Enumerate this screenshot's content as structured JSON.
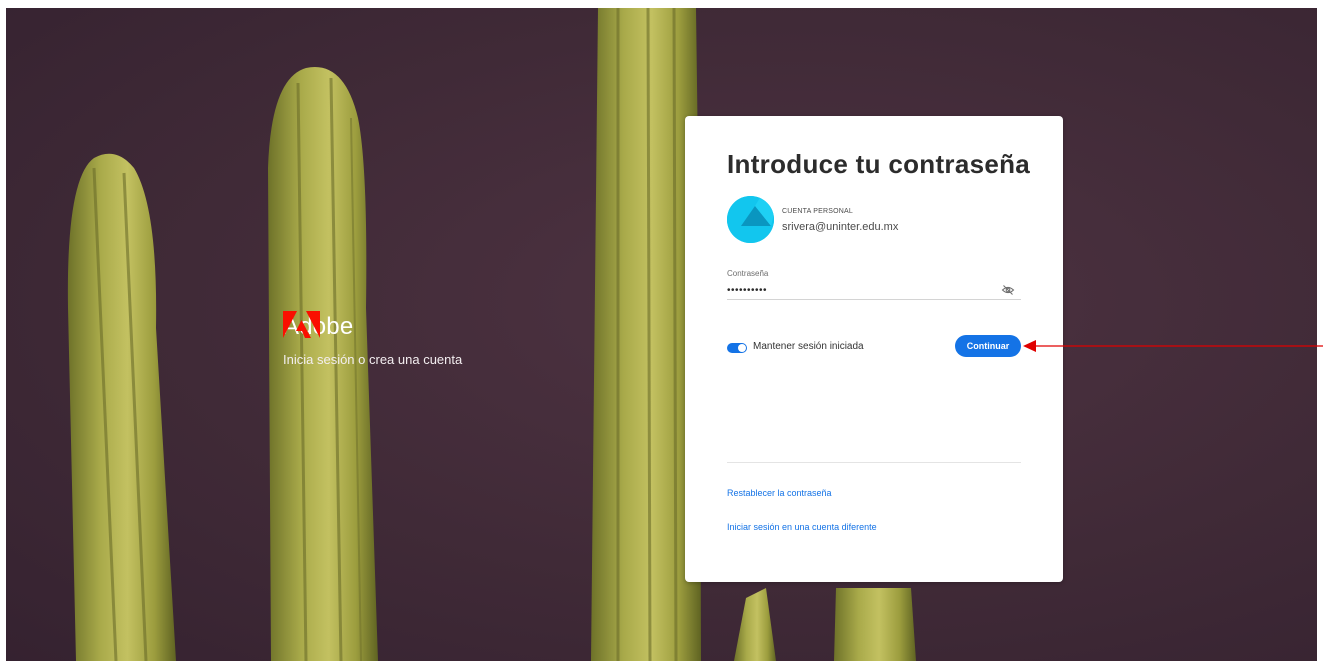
{
  "brand": {
    "name": "Adobe",
    "tagline": "Inicia sesión o crea una cuenta",
    "logo_color": "#fa0f00"
  },
  "card": {
    "title": "Introduce tu contraseña",
    "account_type": "CUENTA PERSONAL",
    "account_email": "srivera@uninter.edu.mx",
    "avatar_color": "#12c6ee",
    "password_label": "Contraseña",
    "password_value": "••••••••••",
    "password_visibility_icon": "eye-slash-icon",
    "keep_signed_in_label": "Mantener sesión iniciada",
    "keep_signed_in": true,
    "continue_label": "Continuar",
    "reset_password_link": "Restablecer la contraseña",
    "other_account_link": "Iniciar sesión en una cuenta diferente"
  },
  "colors": {
    "accent": "#1473e6",
    "annotation": "#e00000"
  }
}
